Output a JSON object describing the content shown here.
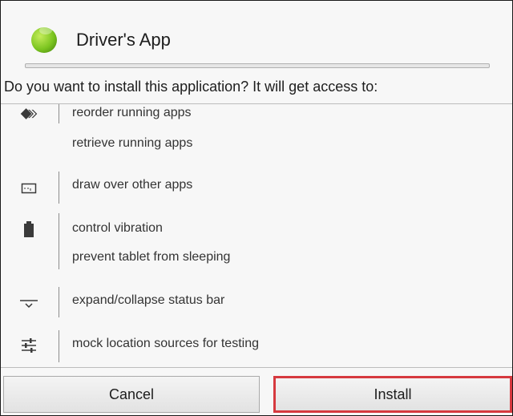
{
  "header": {
    "app_title": "Driver's App"
  },
  "prompt": "Do you want to install this application? It will get access to:",
  "permissions": [
    {
      "icon": "running-apps-icon",
      "lines": [
        "reorder running apps",
        "retrieve running apps"
      ]
    },
    {
      "icon": "window-overlay-icon",
      "lines": [
        "draw over other apps"
      ]
    },
    {
      "icon": "battery-icon",
      "lines": [
        "control vibration",
        "prevent tablet from sleeping"
      ]
    },
    {
      "icon": "status-bar-icon",
      "lines": [
        "expand/collapse status bar"
      ]
    },
    {
      "icon": "sliders-icon",
      "lines": [
        "mock location sources for testing"
      ]
    }
  ],
  "buttons": {
    "cancel": "Cancel",
    "install": "Install"
  },
  "colors": {
    "install_border": "#d6393f",
    "app_icon": "#7cc520"
  }
}
